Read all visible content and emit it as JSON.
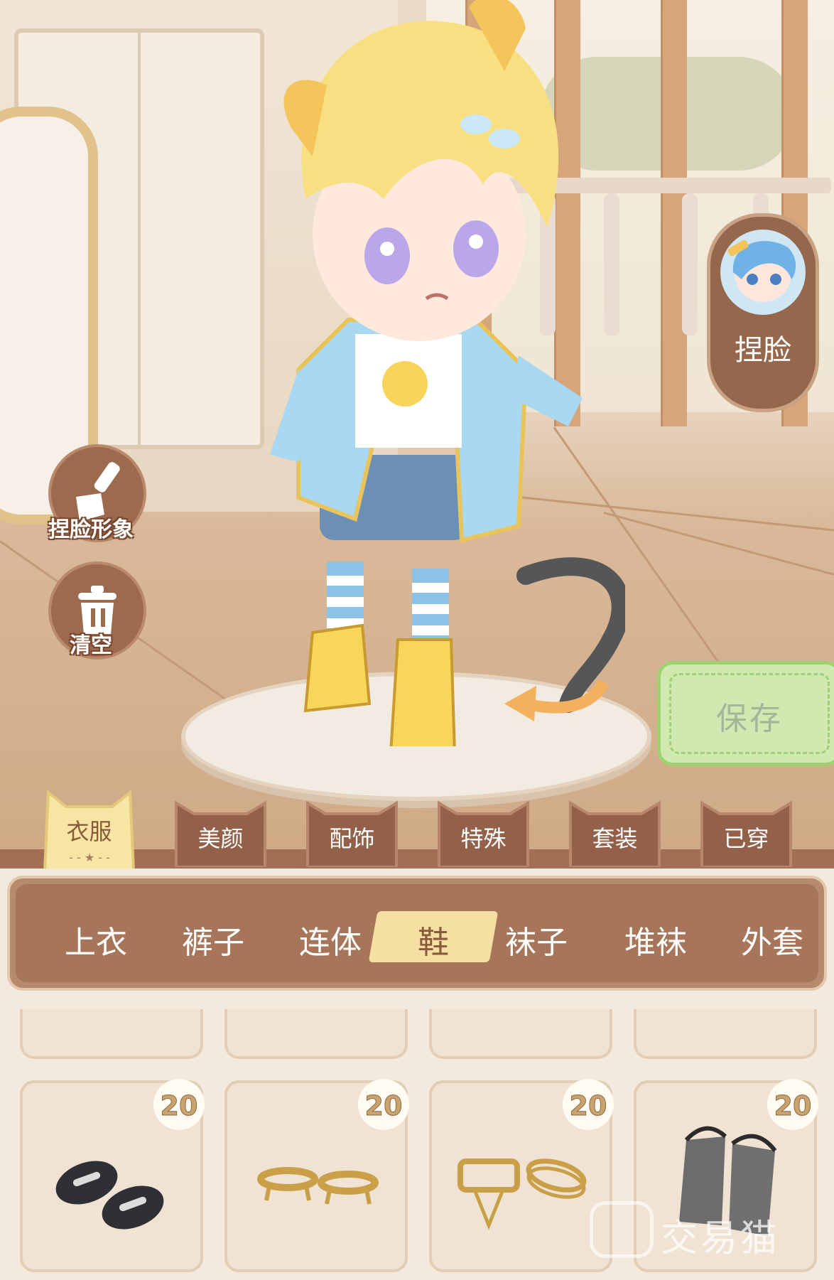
{
  "left_tools": [
    {
      "label": "捏脸形象",
      "icon": "brush-icon"
    },
    {
      "label": "清空",
      "icon": "trash-icon"
    }
  ],
  "face_button": {
    "label": "捏脸",
    "icon": "avatar-comb-icon"
  },
  "save_button": {
    "label": "保存"
  },
  "category_tabs": [
    {
      "label": "衣服",
      "active": true
    },
    {
      "label": "美颜"
    },
    {
      "label": "配饰"
    },
    {
      "label": "特殊"
    },
    {
      "label": "套装"
    },
    {
      "label": "已穿"
    }
  ],
  "sub_tabs": [
    {
      "label": "上衣"
    },
    {
      "label": "裤子"
    },
    {
      "label": "连体"
    },
    {
      "label": "鞋",
      "active": true
    },
    {
      "label": "袜子"
    },
    {
      "label": "堆袜"
    },
    {
      "label": "外套"
    }
  ],
  "items": [
    {
      "price": "20",
      "icon": "black-sandals-icon"
    },
    {
      "price": "20",
      "icon": "gold-anklets-icon"
    },
    {
      "price": "20",
      "icon": "gold-chain-anklet-icon"
    },
    {
      "price": "20",
      "icon": "grey-boots-icon"
    }
  ],
  "watermark": "交易猫",
  "colors": {
    "accent_brown": "#a77559",
    "active_yellow": "#f5dfa2",
    "save_green": "#cfe9b1"
  }
}
